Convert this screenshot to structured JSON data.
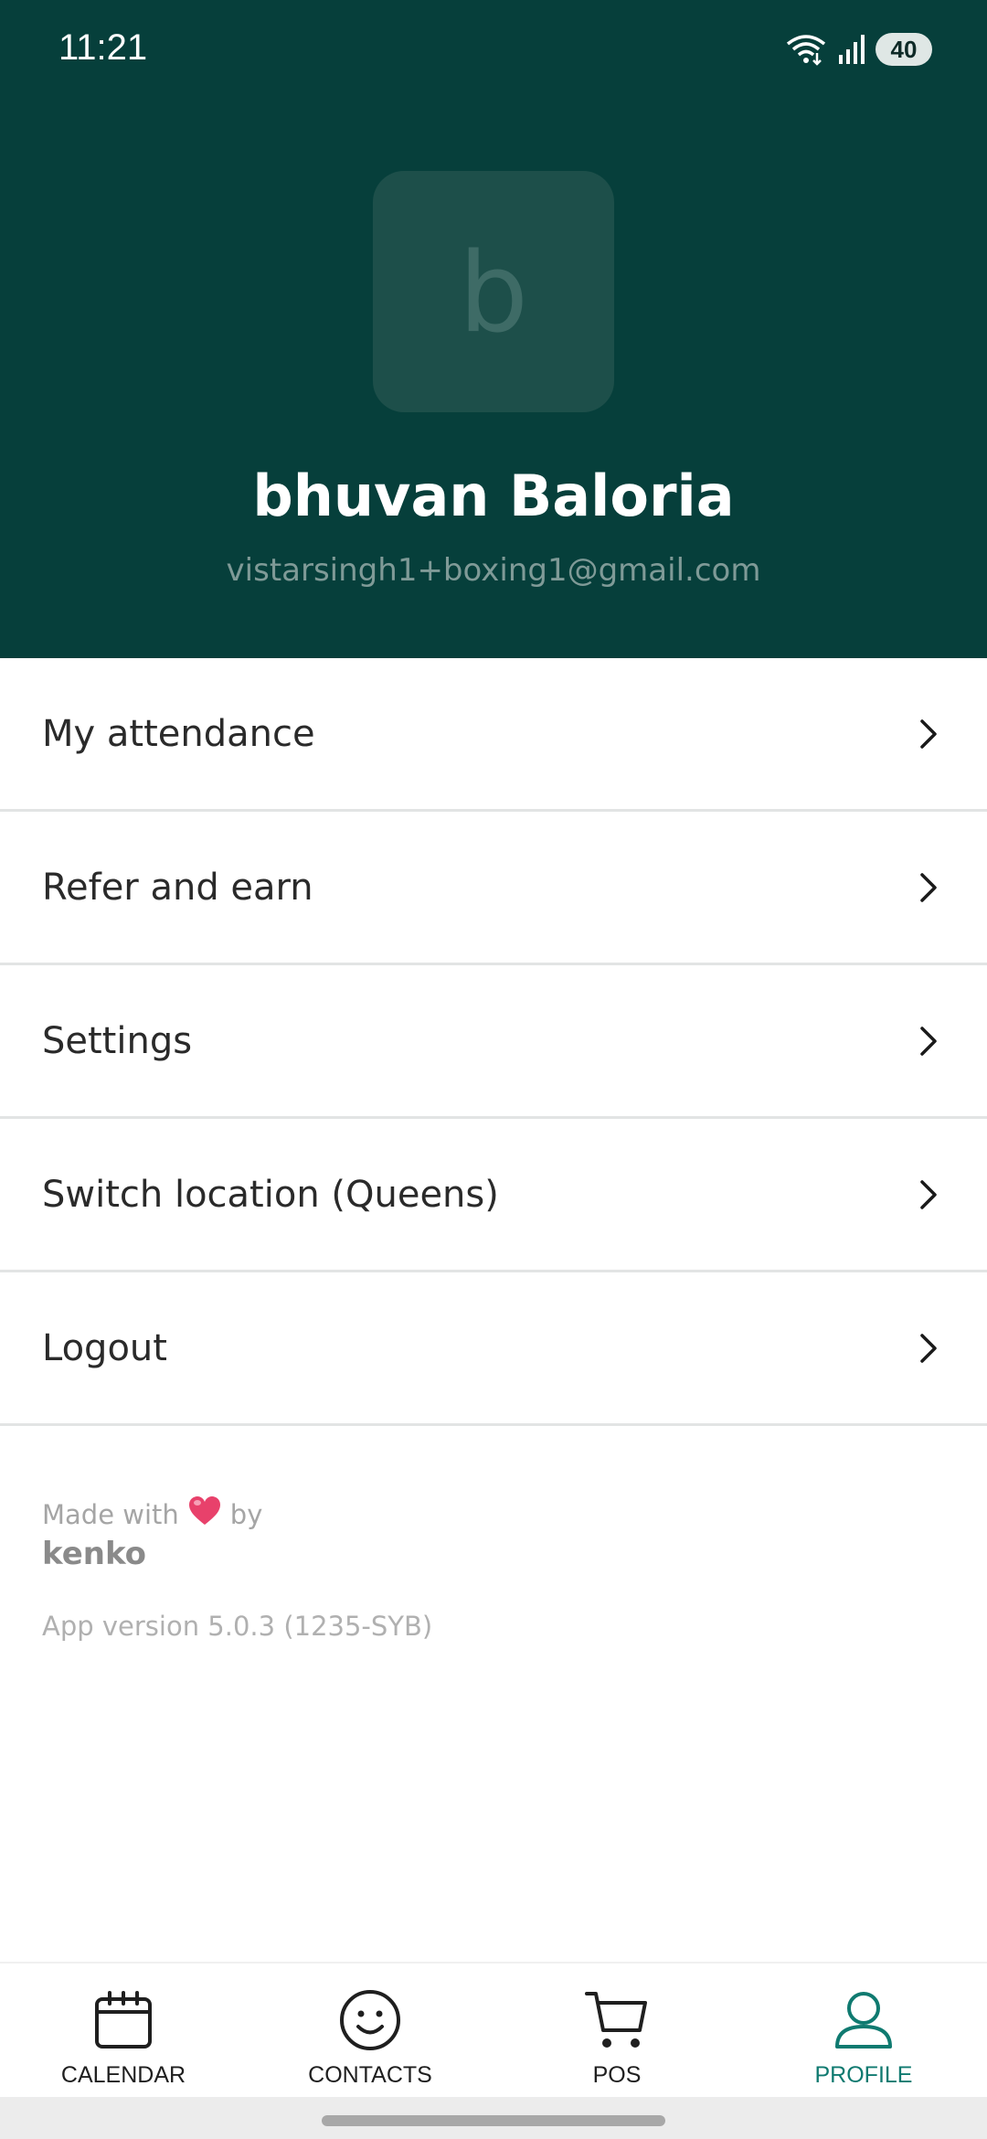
{
  "status_bar": {
    "time": "11:21",
    "battery": "40",
    "icons": [
      "wifi-icon",
      "signal-icon",
      "battery-icon"
    ]
  },
  "profile": {
    "avatar_letter": "b",
    "name": "bhuvan Baloria",
    "email": "vistarsingh1+boxing1@gmail.com"
  },
  "menu": {
    "items": [
      {
        "label": "My attendance"
      },
      {
        "label": "Refer and earn"
      },
      {
        "label": "Settings"
      },
      {
        "label": "Switch location (Queens)"
      },
      {
        "label": "Logout"
      }
    ]
  },
  "footer": {
    "made_with_prefix": "Made with",
    "made_with_suffix": "by",
    "brand": "kenko",
    "app_version": "App version 5.0.3 (1235-SYB)"
  },
  "bottom_nav": {
    "items": [
      {
        "label": "CALENDAR",
        "icon": "calendar-icon"
      },
      {
        "label": "CONTACTS",
        "icon": "smiley-icon"
      },
      {
        "label": "POS",
        "icon": "cart-icon"
      },
      {
        "label": "PROFILE",
        "icon": "person-icon",
        "active": true
      }
    ]
  },
  "colors": {
    "header_bg": "#063f3b",
    "accent": "#0f7a70",
    "heart": "#e8416b"
  }
}
